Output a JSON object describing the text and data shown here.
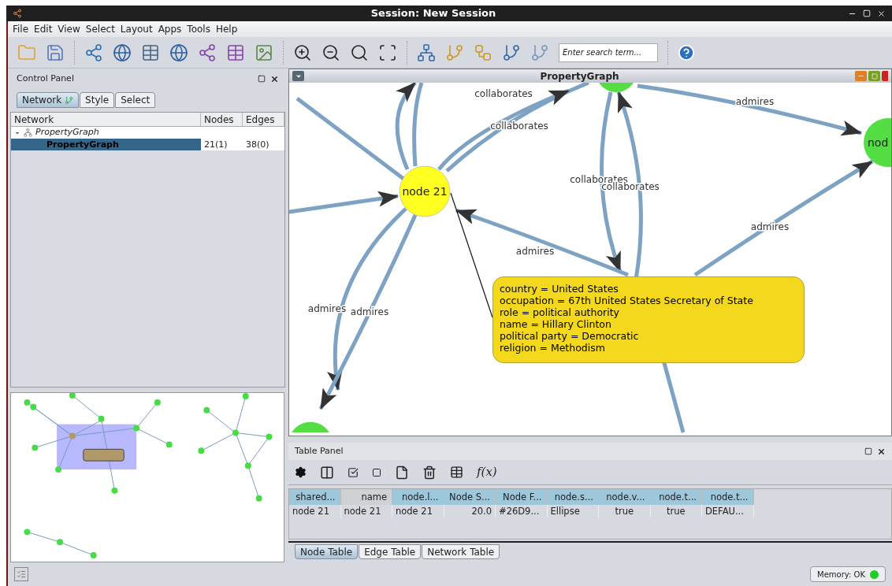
{
  "window": {
    "title": "Session: New Session"
  },
  "menu": [
    "File",
    "Edit",
    "View",
    "Select",
    "Layout",
    "Apps",
    "Tools",
    "Help"
  ],
  "search": {
    "placeholder": "Enter search term..."
  },
  "control_panel": {
    "title": "Control Panel",
    "tabs": [
      {
        "label": "Network",
        "selected": true
      },
      {
        "label": "Style",
        "selected": false
      },
      {
        "label": "Select",
        "selected": false
      }
    ],
    "columns": [
      "Network",
      "Nodes",
      "Edges"
    ],
    "tree": [
      {
        "name": "PropertyGraph",
        "expanded": true,
        "children": [
          {
            "name": "PropertyGraph",
            "selected": true,
            "nodes": "21(1)",
            "edges": "38(0)"
          }
        ]
      }
    ]
  },
  "network_view": {
    "title": "PropertyGraph",
    "nodes": [
      {
        "label": "node 21",
        "selected": true
      },
      {
        "label": "nod",
        "selected": false
      },
      {
        "selected": false
      },
      {
        "selected": false
      }
    ],
    "edges": [
      {
        "label": "collaborates"
      },
      {
        "label": "collaborates"
      },
      {
        "label": "admires"
      },
      {
        "label": "collaborates"
      },
      {
        "label": "collaborates"
      },
      {
        "label": "admires"
      },
      {
        "label": "admires"
      },
      {
        "label": "admires"
      },
      {
        "label": "admires"
      }
    ],
    "tooltip": [
      "country = United States",
      "occupation = 67th United States Secretary of State",
      "role = political authority",
      "name = Hillary Clinton",
      "political party = Democratic",
      "religion = Methodism"
    ]
  },
  "table_panel": {
    "title": "Table Panel",
    "function_label": "f(x)",
    "columns": [
      {
        "label": "shared...",
        "selected": false
      },
      {
        "label": "name",
        "selected": true
      },
      {
        "label": "node.l...",
        "selected": false
      },
      {
        "label": "Node S...",
        "selected": false
      },
      {
        "label": "Node F...",
        "selected": false
      },
      {
        "label": "node.s...",
        "selected": false
      },
      {
        "label": "node.v...",
        "selected": false
      },
      {
        "label": "node.t...",
        "selected": false
      },
      {
        "label": "node.t...",
        "selected": false
      }
    ],
    "rows": [
      [
        "node 21",
        "node 21",
        "node 21",
        "20.0",
        "#26D9...",
        "Ellipse",
        "true",
        "true",
        "DEFAU..."
      ]
    ],
    "tabs": [
      {
        "label": "Node Table",
        "selected": true
      },
      {
        "label": "Edge Table",
        "selected": false
      },
      {
        "label": "Network Table",
        "selected": false
      }
    ]
  },
  "status_bar": {
    "memory": "Memory: OK"
  }
}
